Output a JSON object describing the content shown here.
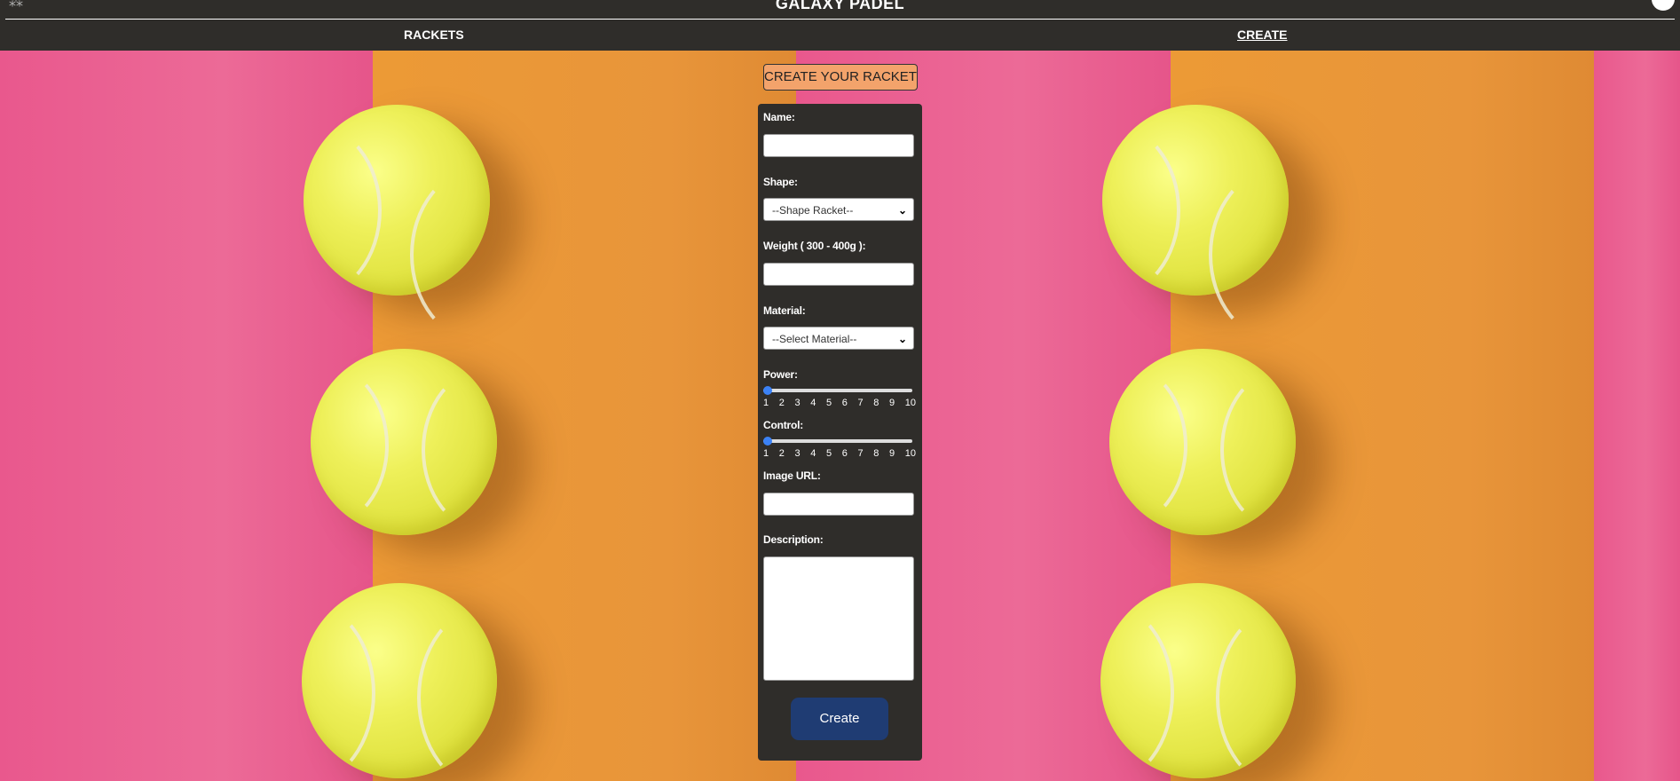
{
  "header": {
    "brand": "GALAXY PADEL",
    "nav": {
      "rackets": "RACKETS",
      "create": "CREATE"
    }
  },
  "form": {
    "title": "CREATE YOUR RACKET",
    "name_label": "Name:",
    "name_value": "",
    "shape_label": "Shape:",
    "shape_selected": "--Shape Racket--",
    "weight_label": "Weight ( 300 - 400g ):",
    "weight_value": "",
    "material_label": "Material:",
    "material_selected": "--Select Material--",
    "power_label": "Power:",
    "power_value": 1,
    "control_label": "Control:",
    "control_value": 1,
    "scale_ticks": [
      "1",
      "2",
      "3",
      "4",
      "5",
      "6",
      "7",
      "8",
      "9",
      "10"
    ],
    "image_url_label": "Image URL:",
    "image_url_value": "",
    "description_label": "Description:",
    "description_value": "",
    "submit_label": "Create"
  },
  "colors": {
    "header_bg": "#2f2d2a",
    "title_bg": "#f3a36b",
    "button_bg": "#1f3c73",
    "slider_thumb": "#3b82f6",
    "bg_pink": "#e9588d",
    "bg_orange": "#ec9a36"
  }
}
